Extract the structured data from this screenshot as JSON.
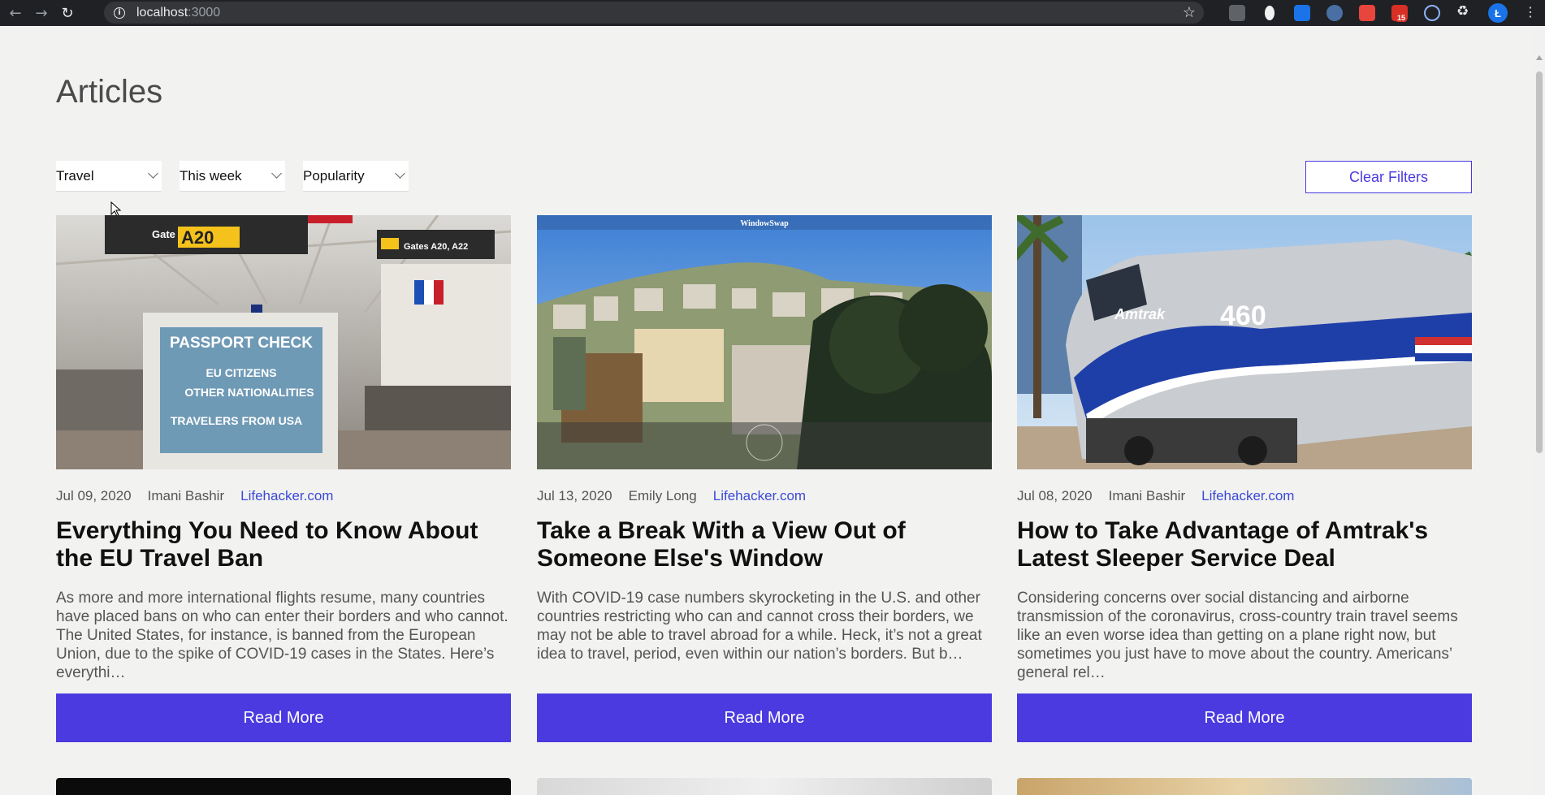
{
  "browser": {
    "url_host": "localhost",
    "url_port": ":3000",
    "avatar_letter": "Ł",
    "extension_badge": "15"
  },
  "page": {
    "title": "Articles"
  },
  "filters": {
    "category": "Travel",
    "period": "This week",
    "sort": "Popularity",
    "clear_label": "Clear Filters"
  },
  "articles": [
    {
      "date": "Jul 09, 2020",
      "author": "Imani Bashir",
      "source": "Lifehacker.com",
      "title": "Everything You Need to Know About the EU Travel Ban",
      "description": "As more and more international flights resume, many countries have placed bans on who can enter their borders and who cannot. The United States, for instance, is banned from the European Union, due to the spike of COVID-19 cases in the States. Here’s everythi…",
      "button": "Read More",
      "image_sign": {
        "gate": "Gate",
        "gate_code": "A20",
        "gates_right": "Gates A20, A22",
        "line1": "PASSPORT CHECK",
        "line2": "EU CITIZENS",
        "line3": "OTHER NATIONALITIES",
        "line4": "TRAVELERS FROM USA"
      }
    },
    {
      "date": "Jul 13, 2020",
      "author": "Emily Long",
      "source": "Lifehacker.com",
      "title": "Take a Break With a View Out of Someone Else's Window",
      "description": "With COVID-19 case numbers skyrocketing in the U.S. and other countries restricting who can and cannot cross their borders, we may not be able to travel abroad for a while. Heck, it’s not a great idea to travel, period, even within our nation’s borders. But b…",
      "button": "Read More",
      "image_caption": "WindowSwap"
    },
    {
      "date": "Jul 08, 2020",
      "author": "Imani Bashir",
      "source": "Lifehacker.com",
      "title": "How to Take Advantage of Amtrak's Latest Sleeper Service Deal",
      "description": "Considering concerns over social distancing and airborne transmission of the coronavirus, cross-country train travel seems like an even worse idea than getting on a plane right now, but sometimes you just have to move about the country. Americans’ general rel…",
      "button": "Read More",
      "image_text": {
        "brand": "Amtrak",
        "number": "460"
      }
    }
  ],
  "colors": {
    "accent": "#4a3ae0",
    "background": "#f2f2f1",
    "link": "#3b4ad6"
  }
}
